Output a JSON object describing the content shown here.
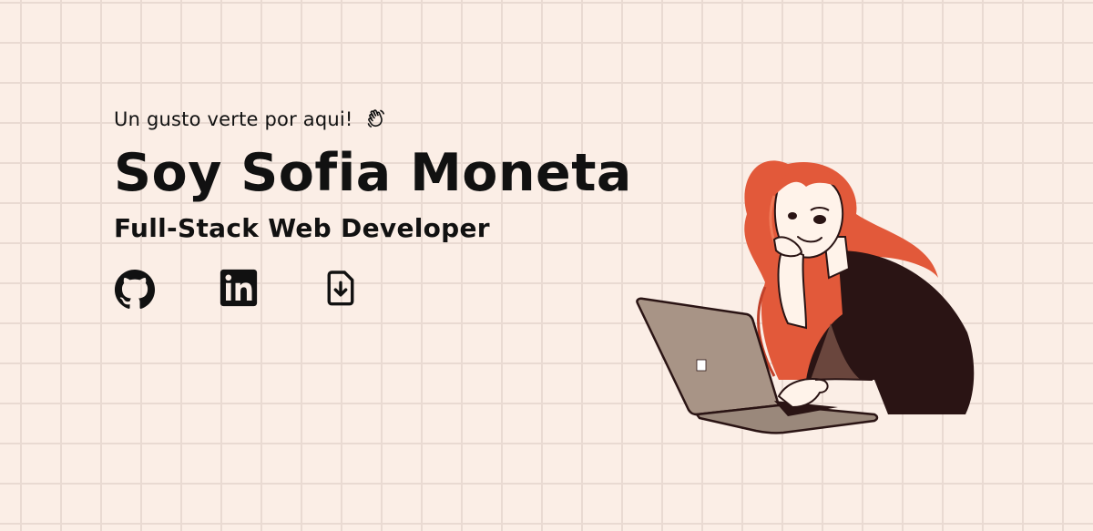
{
  "hero": {
    "greeting": "Un gusto verte por aqui!",
    "greeting_icon": "waving-hand-icon",
    "title": "Soy Sofia Moneta",
    "subtitle": "Full-Stack Web Developer"
  },
  "socials": [
    {
      "icon": "github-icon"
    },
    {
      "icon": "linkedin-icon"
    },
    {
      "icon": "file-download-icon"
    }
  ],
  "illustration": {
    "subject": "woman-with-laptop-illustration"
  },
  "colors": {
    "background": "#fbeee6",
    "grid_line": "#e9dad2",
    "text": "#111111",
    "hair": "#e2593a",
    "jacket": "#2a1414",
    "laptop": "#a89486"
  }
}
